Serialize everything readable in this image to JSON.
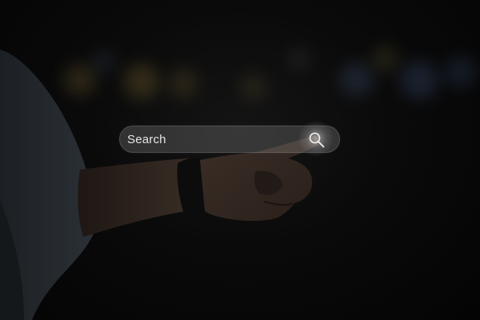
{
  "search": {
    "placeholder": "Search",
    "icon": "search-icon"
  },
  "colors": {
    "background": "#050505",
    "search_bar": "#4a4a4a",
    "search_text": "#e6e6e6"
  }
}
